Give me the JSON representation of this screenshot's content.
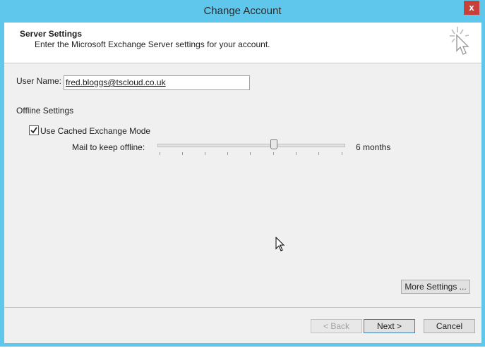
{
  "window": {
    "title": "Change Account",
    "close": "x"
  },
  "header": {
    "title": "Server Settings",
    "subtitle": "Enter the Microsoft Exchange Server settings for your account."
  },
  "form": {
    "username_label": "User Name:",
    "username_value": "fred.bloggs@tscloud.co.uk",
    "offline_heading": "Offline Settings",
    "cached_mode_label": "Use Cached Exchange Mode",
    "cached_mode_checked": true,
    "mail_offline_label": "Mail to keep offline:",
    "mail_offline_value": "6 months",
    "mail_offline_slider_fraction": 0.625
  },
  "buttons": {
    "more_settings": "More Settings ...",
    "back": "< Back",
    "next": "Next >",
    "cancel": "Cancel"
  },
  "colors": {
    "titlebar": "#5fc6ec",
    "close": "#c8403a",
    "client": "#f0f0f0"
  }
}
